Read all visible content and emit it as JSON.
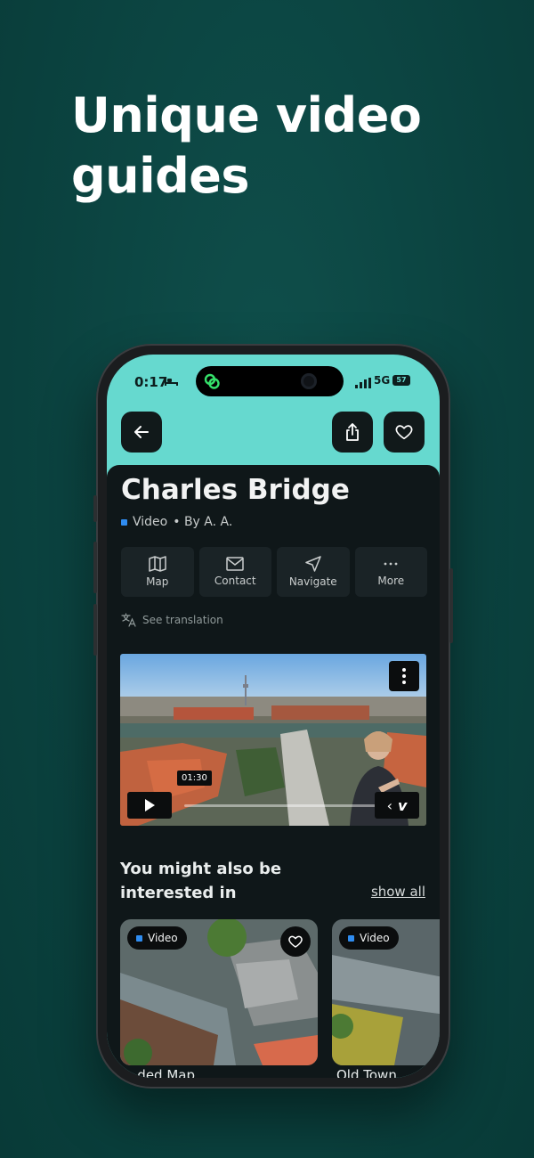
{
  "headline": "Unique video guides",
  "status_bar": {
    "time": "0:17",
    "network": "5G",
    "battery": "57"
  },
  "place": {
    "title": "Charles Bridge",
    "category": "Video",
    "author": "• By A. A."
  },
  "actions": [
    {
      "label": "Map",
      "icon": "map-icon"
    },
    {
      "label": "Contact",
      "icon": "mail-icon"
    },
    {
      "label": "Navigate",
      "icon": "navigate-icon"
    },
    {
      "label": "More",
      "icon": "more-icon"
    }
  ],
  "translation_label": "See translation",
  "video": {
    "tooltip_time": "01:30",
    "progress": 0.0
  },
  "related": {
    "title": "You might also be interested in",
    "show_all": "show all",
    "cards": [
      {
        "badge": "Video",
        "label": "...ded Map..."
      },
      {
        "badge": "Video",
        "label": "Old Town..."
      }
    ]
  },
  "colors": {
    "background": "#0b4340",
    "screen_accent": "#66d9cf",
    "sheet": "#0f1719",
    "video_badge_dot": "#2f8cf0"
  }
}
